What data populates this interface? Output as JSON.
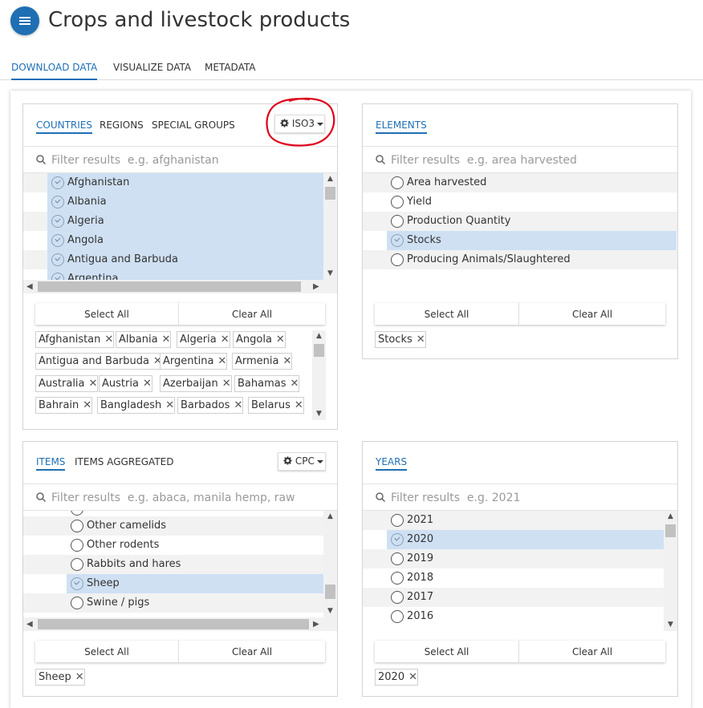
{
  "header": {
    "title": "Crops and livestock products"
  },
  "top_tabs": [
    {
      "label": "DOWNLOAD DATA",
      "active": true
    },
    {
      "label": "VISUALIZE DATA",
      "active": false
    },
    {
      "label": "METADATA",
      "active": false
    }
  ],
  "countries_panel": {
    "tabs": [
      "COUNTRIES",
      "REGIONS",
      "SPECIAL GROUPS"
    ],
    "coding_button": "ISO3",
    "filter_placeholder": "Filter results  e.g. afghanistan",
    "rows": [
      "Afghanistan",
      "Albania",
      "Algeria",
      "Angola",
      "Antigua and Barbuda",
      "Argentina"
    ],
    "select_all": "Select All",
    "clear_all": "Clear All",
    "chips": [
      "Afghanistan",
      "Albania",
      "Algeria",
      "Angola",
      "Antigua and Barbuda",
      "Argentina",
      "Armenia",
      "Australia",
      "Austria",
      "Azerbaijan",
      "Bahamas",
      "Bahrain",
      "Bangladesh",
      "Barbados",
      "Belarus"
    ]
  },
  "elements_panel": {
    "tabs": [
      "ELEMENTS"
    ],
    "filter_placeholder": "Filter results  e.g. area harvested",
    "rows": [
      "Area harvested",
      "Yield",
      "Production Quantity",
      "Stocks",
      "Producing Animals/Slaughtered"
    ],
    "select_all": "Select All",
    "clear_all": "Clear All",
    "chips": [
      "Stocks"
    ]
  },
  "items_panel": {
    "tabs": [
      "ITEMS",
      "ITEMS AGGREGATED"
    ],
    "coding_button": "CPC",
    "filter_placeholder": "Filter results  e.g. abaca, manila hemp, raw",
    "rows": [
      "Other camelids",
      "Other rodents",
      "Rabbits and hares",
      "Sheep",
      "Swine / pigs"
    ],
    "select_all": "Select All",
    "clear_all": "Clear All",
    "chips": [
      "Sheep"
    ]
  },
  "years_panel": {
    "tabs": [
      "YEARS"
    ],
    "filter_placeholder": "Filter results  e.g. 2021",
    "rows": [
      "2021",
      "2020",
      "2019",
      "2018",
      "2017",
      "2016"
    ],
    "select_all": "Select All",
    "clear_all": "Clear All",
    "chips": [
      "2020"
    ]
  },
  "colors": {
    "accent": "#1f6fb4",
    "selected_row": "#cfe0f3",
    "annotation": "#e0001b"
  },
  "icons": {
    "menu": "hamburger-icon",
    "coding": "gear-icon",
    "search": "search-icon",
    "remove": "close-icon"
  }
}
